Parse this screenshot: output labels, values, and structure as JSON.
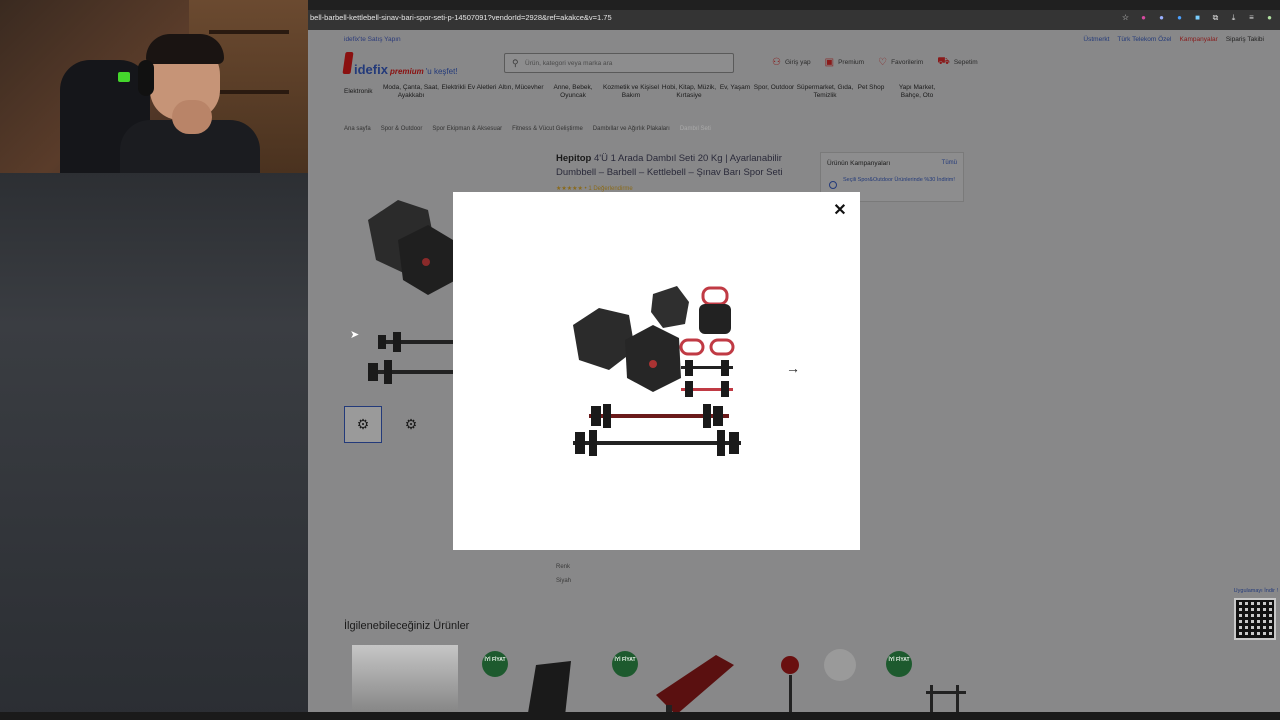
{
  "browser": {
    "url": "bell-barbell-kettlebell-sinav-bari-spor-seti-p-14507091?vendorId=2928&ref=akakce&v=1.75"
  },
  "site": {
    "topline": "idefix'te Satış Yapın",
    "toplinks": [
      "Üstmerkt",
      "Türk Telekom Özel",
      "Kampanyalar",
      "Sipariş Takibi"
    ],
    "logo": {
      "text": "idefix",
      "premium": "premium",
      "tail": "'u keşfet!"
    },
    "search": {
      "placeholder": "Ürün, kategori veya marka ara"
    },
    "account": [
      "Giriş yap",
      "Premium",
      "Favorilerim",
      "Sepetim"
    ],
    "categories": [
      "Elektronik",
      "Moda, Çanta, Saat, Ayakkabı",
      "Elektrikli Ev Aletleri",
      "Altın, Mücevher",
      "Anne, Bebek, Oyuncak",
      "Kozmetik ve Kişisel Bakım",
      "Hobi, Kitap, Müzik, Kırtasiye",
      "Ev, Yaşam",
      "Spor, Outdoor",
      "Süpermarket, Gıda, Temizlik",
      "Pet Shop",
      "Yapı Market, Bahçe, Oto"
    ],
    "breadcrumbs": [
      "Ana sayfa",
      "Spor & Outdoor",
      "Spor Ekipman & Aksesuar",
      "Fitness & Vücut Geliştirme",
      "Dambıllar ve Ağırlık Plakaları",
      "Dambıl Seti"
    ]
  },
  "product": {
    "brand": "Hepitop",
    "title": "4'Ü 1 Arada Dambıl Seti 20 Kg | Ayarlanabilir Dumbbell – Barbell – Kettlebell – Şınav Barı Spor Seti",
    "rating": "★★★★★ • 1 Değerlendirme",
    "colors": [
      "Renk",
      "Siyah"
    ]
  },
  "campaigns": {
    "title": "Ürünün Kampanyaları",
    "all": "Tümü",
    "item": "Seçili Spor&Outdoor Ürünlerinde %30 İndirim!"
  },
  "related": {
    "title": "İlgilenebileceğiniz Ürünler",
    "badge": "İYİ FİYAT"
  },
  "qr": {
    "label": "Uygulamayı İndir !"
  },
  "modal": {
    "close_icon": "close-icon",
    "next_icon": "arrow-right-icon"
  }
}
